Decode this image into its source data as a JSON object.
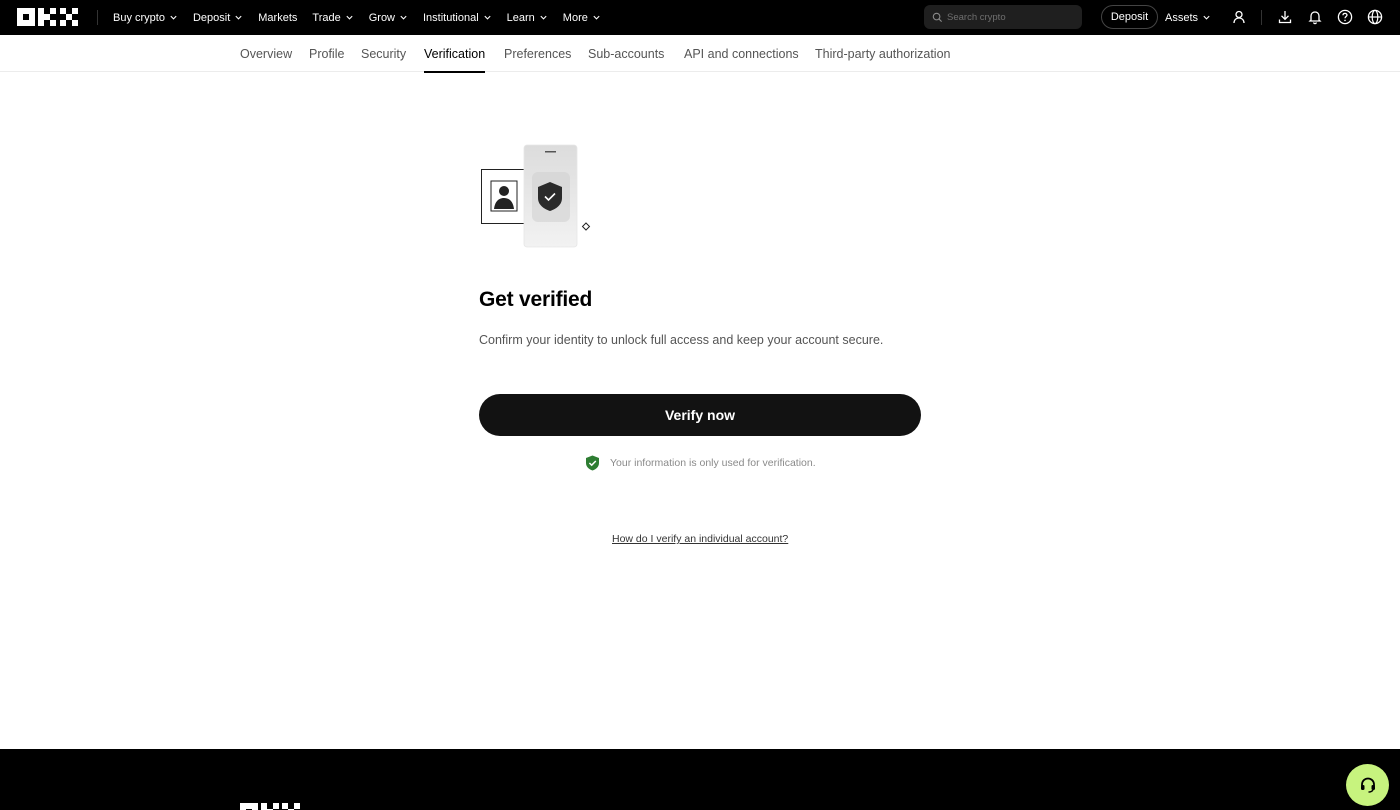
{
  "nav": {
    "items": [
      {
        "label": "Buy crypto",
        "dropdown": true
      },
      {
        "label": "Deposit",
        "dropdown": true
      },
      {
        "label": "Markets",
        "dropdown": false
      },
      {
        "label": "Trade",
        "dropdown": true
      },
      {
        "label": "Grow",
        "dropdown": true
      },
      {
        "label": "Institutional",
        "dropdown": true
      },
      {
        "label": "Learn",
        "dropdown": true
      },
      {
        "label": "More",
        "dropdown": true
      }
    ],
    "search_placeholder": "Search crypto",
    "deposit_label": "Deposit",
    "assets_label": "Assets",
    "icons": [
      "user-icon",
      "download-icon",
      "bell-icon",
      "help-icon",
      "globe-icon"
    ]
  },
  "tabs": [
    {
      "label": "Overview",
      "active": false
    },
    {
      "label": "Profile",
      "active": false
    },
    {
      "label": "Security",
      "active": false
    },
    {
      "label": "Verification",
      "active": true
    },
    {
      "label": "Preferences",
      "active": false
    },
    {
      "label": "Sub-accounts",
      "active": false
    },
    {
      "label": "API and connections",
      "active": false
    },
    {
      "label": "Third-party authorization",
      "active": false
    }
  ],
  "main": {
    "title": "Get verified",
    "subtitle": "Confirm your identity to unlock full access and keep your account secure.",
    "verify_button": "Verify now",
    "privacy_note": "Your information is only used for verification.",
    "help_link": "How do I verify an individual account?"
  },
  "colors": {
    "topbar": "#000000",
    "button": "#121212",
    "shield_green": "#2e7d32",
    "support_bubble": "#c7f37e"
  }
}
